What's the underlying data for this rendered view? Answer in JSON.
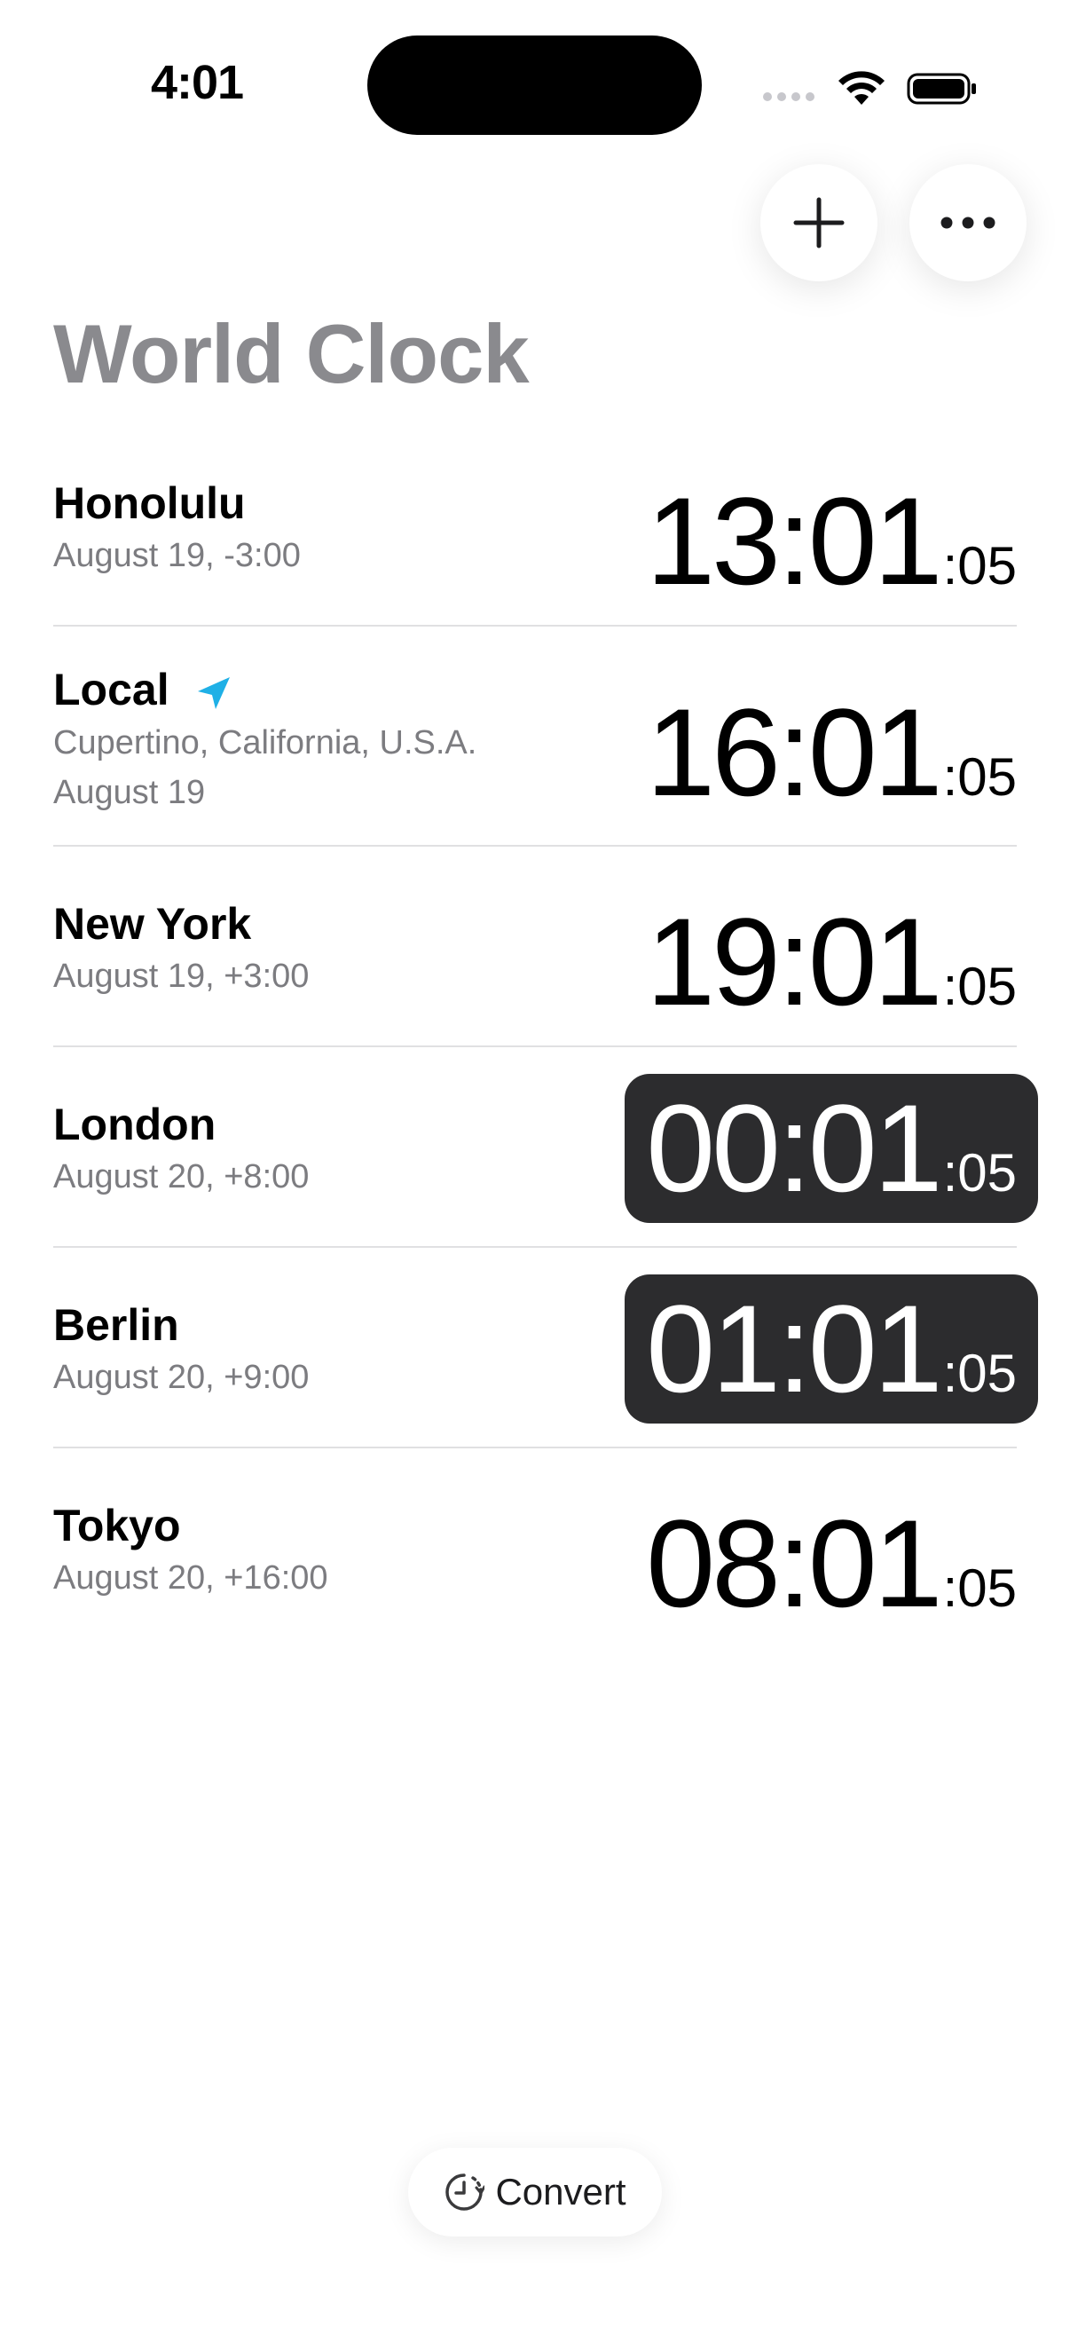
{
  "status": {
    "time": "4:01"
  },
  "header": {
    "title": "World Clock",
    "add_icon": "plus-icon",
    "more_icon": "ellipsis-icon"
  },
  "clocks": [
    {
      "city": "Honolulu",
      "detail": "August 19, -3:00",
      "detail2": "",
      "time": "13:01",
      "seconds": ":05",
      "highlighted": false
    },
    {
      "city": "Local",
      "detail": "Cupertino, California, U.S.A.",
      "detail2": "August 19",
      "time": "16:01",
      "seconds": ":05",
      "highlighted": false
    },
    {
      "city": "New York",
      "detail": "August 19, +3:00",
      "detail2": "",
      "time": "19:01",
      "seconds": ":05",
      "highlighted": false
    },
    {
      "city": "London",
      "detail": "August 20, +8:00",
      "detail2": "",
      "time": "00:01",
      "seconds": ":05",
      "highlighted": true
    },
    {
      "city": "Berlin",
      "detail": "August 20, +9:00",
      "detail2": "",
      "time": "01:01",
      "seconds": ":05",
      "highlighted": true
    },
    {
      "city": "Tokyo",
      "detail": "August 20, +16:00",
      "detail2": "",
      "time": "08:01",
      "seconds": ":05",
      "highlighted": false
    }
  ],
  "footer": {
    "convert_label": "Convert"
  },
  "colors": {
    "title_gray": "#8a8a8e",
    "location_blue": "#1fb0e6",
    "highlight_bg": "#2c2c2e"
  }
}
